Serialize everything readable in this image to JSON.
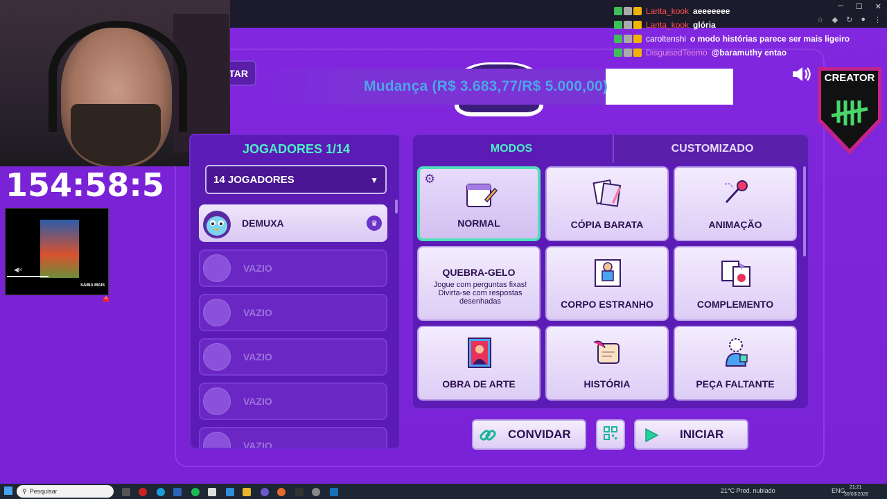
{
  "stream": {
    "timer": "154:58:5",
    "donation_text": "Mudança (R$ 3.683,77/R$ 5.000,00)",
    "creator_label": "CREATOR",
    "mini_player_cta": "SAIBA MAIS",
    "mini_player_badge": "A"
  },
  "chat": [
    {
      "user": "Larita_kook",
      "message": "aeeeeeee",
      "user_color": "#ff4d4d"
    },
    {
      "user": "Larita_kook",
      "message": "glória",
      "user_color": "#ff4d4d"
    },
    {
      "user": "caroltenshi",
      "message": "o modo histórias parece ser mais ligeiro",
      "user_color": "#ffffff"
    },
    {
      "user": "DisguisedTeemo",
      "message": "@baramuthy entao",
      "user_color": "#e48ae0"
    }
  ],
  "game": {
    "back_label": "TAR",
    "players": {
      "title": "JOGADORES 1/14",
      "select_value": "14 JOGADORES",
      "slots": [
        {
          "name": "DEMUXA",
          "filled": true
        },
        {
          "name": "VAZIO",
          "filled": false
        },
        {
          "name": "VAZIO",
          "filled": false
        },
        {
          "name": "VAZIO",
          "filled": false
        },
        {
          "name": "VAZIO",
          "filled": false
        },
        {
          "name": "VAZIO",
          "filled": false
        }
      ]
    },
    "tabs": {
      "modes": "MODOS",
      "custom": "CUSTOMIZADO"
    },
    "modes": [
      {
        "label": "NORMAL",
        "icon": "calendar-pencil-icon"
      },
      {
        "label": "CÓPIA BARATA",
        "icon": "copy-cards-icon"
      },
      {
        "label": "ANIMAÇÃO",
        "icon": "animation-icon"
      },
      {
        "label": "QUEBRA-GELO",
        "description": "Jogue com perguntas fixas! Divirta-se com respostas desenhadas"
      },
      {
        "label": "CORPO ESTRANHO",
        "icon": "strange-body-icon"
      },
      {
        "label": "COMPLEMENTO",
        "icon": "complement-icon"
      },
      {
        "label": "OBRA DE ARTE",
        "icon": "mona-lisa-icon"
      },
      {
        "label": "HISTÓRIA",
        "icon": "scroll-quill-icon"
      },
      {
        "label": "PEÇA FALTANTE",
        "icon": "puzzle-person-icon"
      }
    ],
    "buttons": {
      "invite": "CONVIDAR",
      "start": "INICIAR"
    }
  },
  "taskbar": {
    "search_placeholder": "Pesquisar",
    "weather": "21°C  Pred. nublado",
    "lang": "ENG",
    "time": "21:21",
    "date": "30/03/2026"
  },
  "colors": {
    "accent_teal": "#4cf0c8",
    "panel": "#5c1bb5",
    "bg": "#7a22d6"
  }
}
